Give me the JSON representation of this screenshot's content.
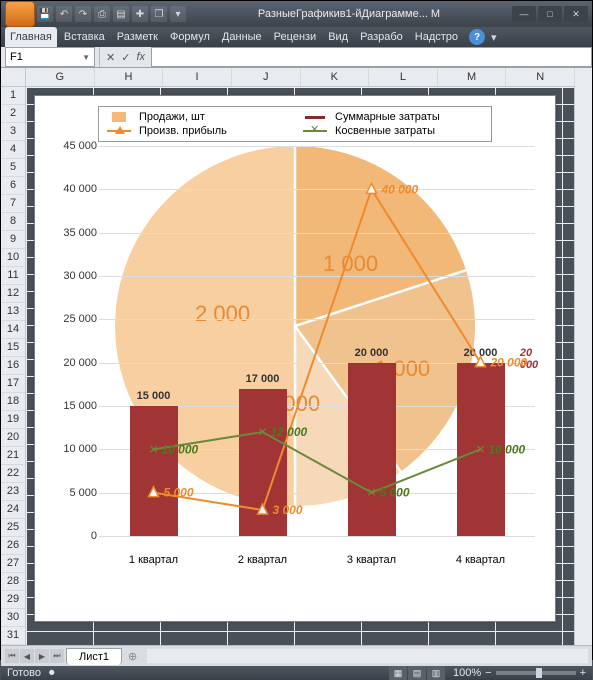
{
  "titlebar": {
    "title": "РазныеГрафикив1-йДиаграмме... М"
  },
  "ribbon": {
    "tabs": [
      "Главная",
      "Вставка",
      "Разметк",
      "Формул",
      "Данные",
      "Рецензи",
      "Вид",
      "Разрабо",
      "Надстро"
    ]
  },
  "formula_bar": {
    "namebox": "F1",
    "fx": "fx"
  },
  "columns": [
    "G",
    "H",
    "I",
    "J",
    "K",
    "L",
    "M",
    "N"
  ],
  "rows_visible": 31,
  "sheet_tab": "Лист1",
  "status": {
    "ready": "Готово",
    "zoom": "100%",
    "zoom_minus": "−",
    "zoom_plus": "+"
  },
  "legend": {
    "s1": "Продажи, шт",
    "s2": "Суммарные затраты",
    "s3": "Произв. прибыль",
    "s4": "Косвенные затраты"
  },
  "chart_data": {
    "type": "combo",
    "categories": [
      "1 квартал",
      "2 квартал",
      "3 квартал",
      "4 квартал"
    ],
    "ylim": [
      0,
      45000
    ],
    "yticks": [
      0,
      5000,
      10000,
      15000,
      20000,
      25000,
      30000,
      35000,
      40000,
      45000
    ],
    "ytick_labels": [
      "0",
      "5 000",
      "10 000",
      "15 000",
      "20 000",
      "25 000",
      "30 000",
      "35 000",
      "40 000",
      "45 000"
    ],
    "series": [
      {
        "name": "Продажи, шт",
        "type": "pie",
        "values": [
          2000,
          3000,
          1000,
          1000
        ],
        "labels": [
          "2 000",
          "3 000",
          "1 000",
          "1 000"
        ]
      },
      {
        "name": "Суммарные затраты",
        "type": "bar",
        "values": [
          15000,
          17000,
          20000,
          20000
        ],
        "labels": [
          "15 000",
          "17 000",
          "20 000",
          "20 000"
        ],
        "last_side_label": "20 000"
      },
      {
        "name": "Произв. прибыль",
        "type": "line",
        "values": [
          5000,
          3000,
          40000,
          20000
        ],
        "labels": [
          "5 000",
          "3 000",
          "40 000",
          "20 000"
        ]
      },
      {
        "name": "Косвенные затраты",
        "type": "line",
        "values": [
          10000,
          12000,
          5000,
          10000
        ],
        "labels": [
          "10 000",
          "12 000",
          "5 000",
          "10 000"
        ]
      }
    ]
  }
}
